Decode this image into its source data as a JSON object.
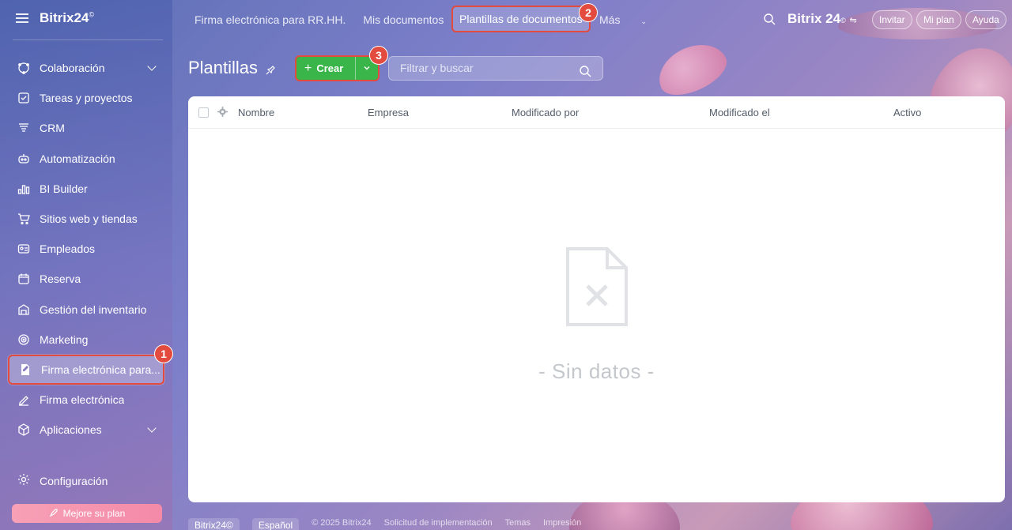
{
  "app": {
    "logo": "Bitrix24",
    "logo_mark": "©"
  },
  "sidebar": {
    "items": [
      {
        "label": "Colaboración",
        "icon": "chat-bubbles-icon",
        "has_chevron": true
      },
      {
        "label": "Tareas y proyectos",
        "icon": "checkbox-icon"
      },
      {
        "label": "CRM",
        "icon": "crm-filter-icon"
      },
      {
        "label": "Automatización",
        "icon": "robot-icon"
      },
      {
        "label": "BI Builder",
        "icon": "bar-chart-icon"
      },
      {
        "label": "Sitios web y tiendas",
        "icon": "cart-icon"
      },
      {
        "label": "Empleados",
        "icon": "id-card-icon"
      },
      {
        "label": "Reserva",
        "icon": "calendar-icon"
      },
      {
        "label": "Gestión del inventario",
        "icon": "warehouse-icon"
      },
      {
        "label": "Marketing",
        "icon": "target-icon"
      },
      {
        "label": "Firma electrónica para...",
        "icon": "signed-document-icon",
        "active": true
      },
      {
        "label": "Firma electrónica",
        "icon": "signature-pen-icon"
      },
      {
        "label": "Aplicaciones",
        "icon": "cube-icon",
        "has_chevron": true
      }
    ],
    "settings_label": "Configuración",
    "upgrade_label": "Mejore su plan"
  },
  "topnav": {
    "items": [
      "Firma electrónica para RR.HH.",
      "Mis documentos"
    ],
    "selected": "Plantillas de documentos",
    "more": "Más"
  },
  "header_right": {
    "brand": "Bitrix 24",
    "invite": "Invitar",
    "plan": "Mi plan",
    "help": "Ayuda"
  },
  "page": {
    "title": "Plantillas",
    "create_label": "Crear",
    "filter_placeholder": "Filtrar y buscar"
  },
  "grid": {
    "columns": [
      "Nombre",
      "Empresa",
      "Modificado por",
      "Modificado el",
      "Activo"
    ],
    "empty_text": "- Sin datos -"
  },
  "badges": [
    "1",
    "2",
    "3"
  ],
  "footer": {
    "brand": "Bitrix24©",
    "language": "Español",
    "copyright": "© 2025 Bitrix24",
    "links": [
      "Solicitud de implementación",
      "Temas",
      "Impresión"
    ]
  },
  "colors": {
    "accent_green": "#39b54a",
    "highlight_red": "#e34b3f"
  }
}
